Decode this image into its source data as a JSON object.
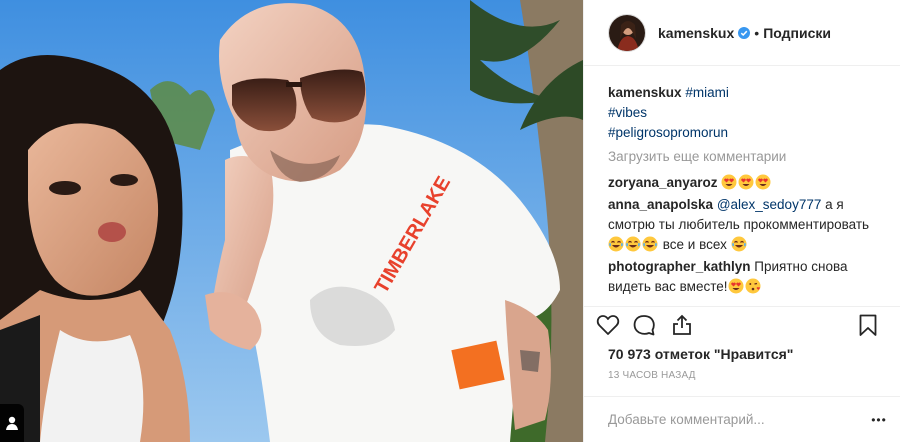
{
  "post": {
    "author": "kamenskux",
    "header_separator": "•",
    "follow_label": "Подписки",
    "verified_icon": "verified-badge-icon",
    "caption": {
      "user": "kamenskux",
      "hashtags": [
        "#miami",
        "#vibes",
        "#peligrosopromorun"
      ]
    },
    "load_more_label": "Загрузить еще комментарии",
    "comments": [
      {
        "user": "zoryana_anyaroz",
        "text": "",
        "emoji": [
          "heart-eyes",
          "heart-eyes",
          "heart-eyes"
        ]
      },
      {
        "user": "anna_anapolska",
        "mention": "@alex_sedoy777",
        "text": "а я смотрю ты любитель прокомментировать",
        "emoji_after": [
          "tears-of-joy",
          "tears-of-joy",
          "tears-of-joy"
        ],
        "text2": "все и всех",
        "emoji_end": [
          "tears-of-joy"
        ]
      },
      {
        "user": "photographer_kathlyn",
        "text": "Приятно снова видеть вас вместе!",
        "emoji": [
          "heart-eyes",
          "kissing-heart"
        ]
      }
    ],
    "likes_label": "70 973 отметок \"Нравится\"",
    "timestamp": "13 ЧАСОВ НАЗАД",
    "add_comment_placeholder": "Добавьте комментарий...",
    "more_label": "•••",
    "photo": {
      "shirt_print": "TIMBERLAKE",
      "tag_icon": "user-tag-icon"
    },
    "colors": {
      "link": "#003569",
      "muted": "#999999",
      "text": "#262626",
      "verified": "#3897f0",
      "sky": "#6fa8de",
      "shirt_red": "#e8412c",
      "tag_orange": "#f37021"
    }
  }
}
